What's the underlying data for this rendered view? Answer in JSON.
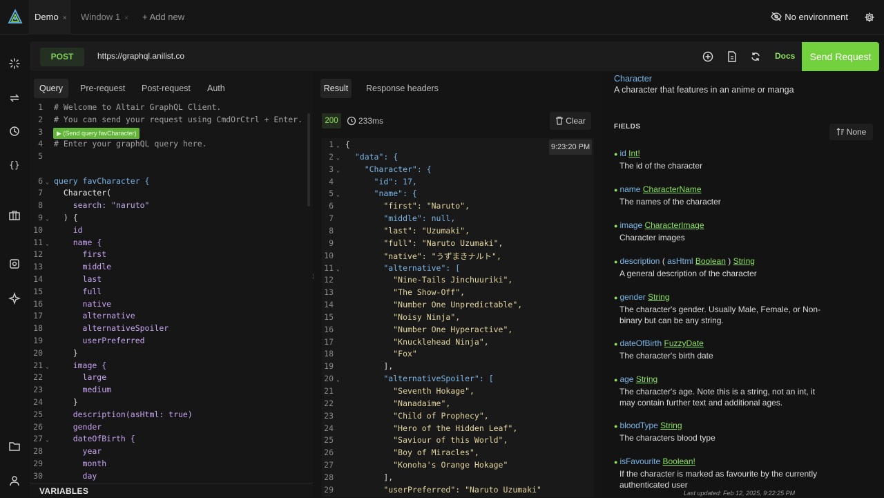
{
  "tabs": [
    {
      "label": "Demo",
      "close": "×"
    },
    {
      "label": "Window 1",
      "close": "×"
    }
  ],
  "add_tab": "+ Add new",
  "environment": "No environment",
  "request": {
    "method": "POST",
    "url": "https://graphql.anilist.co",
    "docs_label": "Docs",
    "send_label": "Send Request"
  },
  "query_tabs": [
    "Query",
    "Pre-request",
    "Post-request",
    "Auth"
  ],
  "send_query_hint": "▶ (Send query favCharacter)",
  "query_lines": [
    {
      "n": "1",
      "t": "# Welcome to Altair GraphQL Client.",
      "c": "cm"
    },
    {
      "n": "2",
      "t": "# You can send your request using CmdOrCtrl + Enter.",
      "c": "cm"
    },
    {
      "n": "3",
      "t": "",
      "c": ""
    },
    {
      "n": "4",
      "t": "# Enter your graphQL query here.",
      "c": "cm"
    },
    {
      "n": "5",
      "t": "",
      "c": ""
    },
    {
      "n": "6",
      "t": "query favCharacter {",
      "c": "q",
      "f": true
    },
    {
      "n": "7",
      "t": "  Character(",
      "c": "fn"
    },
    {
      "n": "8",
      "t": "    search: \"naruto\"",
      "c": "arg"
    },
    {
      "n": "9",
      "t": "  ) {",
      "c": "",
      "f": true
    },
    {
      "n": "10",
      "t": "    id",
      "c": "fld"
    },
    {
      "n": "11",
      "t": "    name {",
      "c": "fld",
      "f": true
    },
    {
      "n": "12",
      "t": "      first",
      "c": "fld"
    },
    {
      "n": "13",
      "t": "      middle",
      "c": "fld"
    },
    {
      "n": "14",
      "t": "      last",
      "c": "fld"
    },
    {
      "n": "15",
      "t": "      full",
      "c": "fld"
    },
    {
      "n": "16",
      "t": "      native",
      "c": "fld"
    },
    {
      "n": "17",
      "t": "      alternative",
      "c": "fld"
    },
    {
      "n": "18",
      "t": "      alternativeSpoiler",
      "c": "fld"
    },
    {
      "n": "19",
      "t": "      userPreferred",
      "c": "fld"
    },
    {
      "n": "20",
      "t": "    }",
      "c": ""
    },
    {
      "n": "21",
      "t": "    image {",
      "c": "fld",
      "f": true
    },
    {
      "n": "22",
      "t": "      large",
      "c": "fld"
    },
    {
      "n": "23",
      "t": "      medium",
      "c": "fld"
    },
    {
      "n": "24",
      "t": "    }",
      "c": ""
    },
    {
      "n": "25",
      "t": "    description(asHtml: true)",
      "c": "desc"
    },
    {
      "n": "26",
      "t": "    gender",
      "c": "fld"
    },
    {
      "n": "27",
      "t": "    dateOfBirth {",
      "c": "fld",
      "f": true
    },
    {
      "n": "28",
      "t": "      year",
      "c": "fld"
    },
    {
      "n": "29",
      "t": "      month",
      "c": "fld"
    },
    {
      "n": "30",
      "t": "      day",
      "c": "fld"
    }
  ],
  "variables_label": "VARIABLES",
  "result_tabs": [
    "Result",
    "Response headers"
  ],
  "status": "200",
  "duration": "233ms",
  "clear_label": "Clear",
  "timestamp": "9:23:20 PM",
  "result_lines": [
    {
      "n": "1",
      "t": "{",
      "f": true
    },
    {
      "n": "2",
      "t": "  \"data\": {",
      "f": true
    },
    {
      "n": "3",
      "t": "    \"Character\": {",
      "f": true
    },
    {
      "n": "4",
      "t": "      \"id\": 17,"
    },
    {
      "n": "5",
      "t": "      \"name\": {",
      "f": true
    },
    {
      "n": "6",
      "t": "        \"first\": \"Naruto\","
    },
    {
      "n": "7",
      "t": "        \"middle\": null,"
    },
    {
      "n": "8",
      "t": "        \"last\": \"Uzumaki\","
    },
    {
      "n": "9",
      "t": "        \"full\": \"Naruto Uzumaki\","
    },
    {
      "n": "10",
      "t": "        \"native\": \"うずまきナルト\","
    },
    {
      "n": "11",
      "t": "        \"alternative\": [",
      "f": true
    },
    {
      "n": "12",
      "t": "          \"Nine-Tails Jinchuuriki\","
    },
    {
      "n": "13",
      "t": "          \"The Show-Off\","
    },
    {
      "n": "14",
      "t": "          \"Number One Unpredictable\","
    },
    {
      "n": "15",
      "t": "          \"Noisy Ninja\","
    },
    {
      "n": "16",
      "t": "          \"Number One Hyperactive\","
    },
    {
      "n": "17",
      "t": "          \"Knucklehead Ninja\","
    },
    {
      "n": "18",
      "t": "          \"Fox\""
    },
    {
      "n": "19",
      "t": "        ],"
    },
    {
      "n": "20",
      "t": "        \"alternativeSpoiler\": [",
      "f": true
    },
    {
      "n": "21",
      "t": "          \"Seventh Hokage\","
    },
    {
      "n": "22",
      "t": "          \"Nanadaime\","
    },
    {
      "n": "23",
      "t": "          \"Child of Prophecy\","
    },
    {
      "n": "24",
      "t": "          \"Hero of the Hidden Leaf\","
    },
    {
      "n": "25",
      "t": "          \"Saviour of this World\","
    },
    {
      "n": "26",
      "t": "          \"Boy of Miracles\","
    },
    {
      "n": "27",
      "t": "          \"Konoha's Orange Hokage\""
    },
    {
      "n": "28",
      "t": "        ],"
    },
    {
      "n": "29",
      "t": "        \"userPreferred\": \"Naruto Uzumaki\""
    }
  ],
  "docs": {
    "title": "Character",
    "description": "A character that features in an anime or manga",
    "fields_heading": "FIELDS",
    "sort_label": "None",
    "fields": [
      {
        "name": "id",
        "type": "Int!",
        "desc": "The id of the character"
      },
      {
        "name": "name",
        "type": "CharacterName",
        "desc": "The names of the character"
      },
      {
        "name": "image",
        "type": "CharacterImage",
        "desc": "Character images"
      },
      {
        "name": "description",
        "arg_open": "(",
        "arg": "asHtml",
        "arg_type": "Boolean",
        "arg_close": ")",
        "type": "String",
        "desc": "A general description of the character"
      },
      {
        "name": "gender",
        "type": "String",
        "desc": "The character's gender. Usually Male, Female, or Non-binary but can be any string."
      },
      {
        "name": "dateOfBirth",
        "type": "FuzzyDate",
        "desc": "The character's birth date"
      },
      {
        "name": "age",
        "type": "String",
        "desc": "The character's age. Note this is a string, not an int, it may contain further text and additional ages."
      },
      {
        "name": "bloodType",
        "type": "String",
        "desc": "The characters blood type"
      },
      {
        "name": "isFavourite",
        "type": "Boolean!",
        "desc": "If the character is marked as favourite by the currently authenticated user"
      }
    ],
    "last_updated": "Last updated: Feb 12, 2025, 9:22:25 PM"
  }
}
